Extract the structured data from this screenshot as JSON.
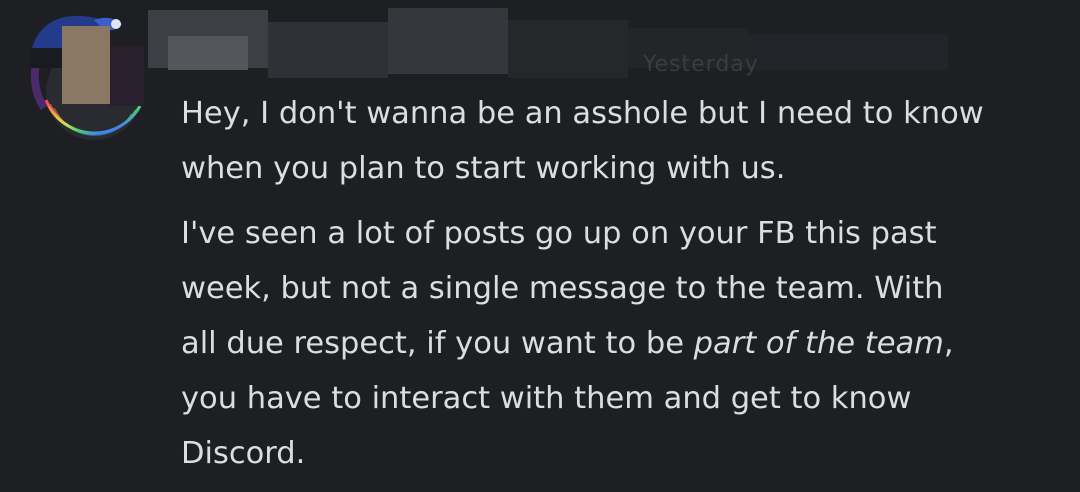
{
  "message": {
    "timestamp": "Yesterday",
    "paragraph_1_lines": [
      "Hey, I don't wanna be an asshole but I need to know",
      "when you plan to start working with us."
    ],
    "paragraph_2": {
      "line_1": "I've seen a lot of posts go up on your FB this past",
      "line_2": "week, but not a single message to the team. With",
      "line_3_before": "all due respect, if you want to be ",
      "line_3_italic": "part of the team",
      "line_3_after": ",",
      "line_4": "you have to interact with them and get to know",
      "line_5": "Discord."
    }
  },
  "colors": {
    "background": "#1e1f22",
    "text": "#dbdee1",
    "timestamp": "#4e5058",
    "avatar_decoration": "rainbow-ring"
  },
  "icons": {
    "avatar": "user-avatar-icon",
    "decoration": "avatar-rainbow-ring-icon"
  }
}
